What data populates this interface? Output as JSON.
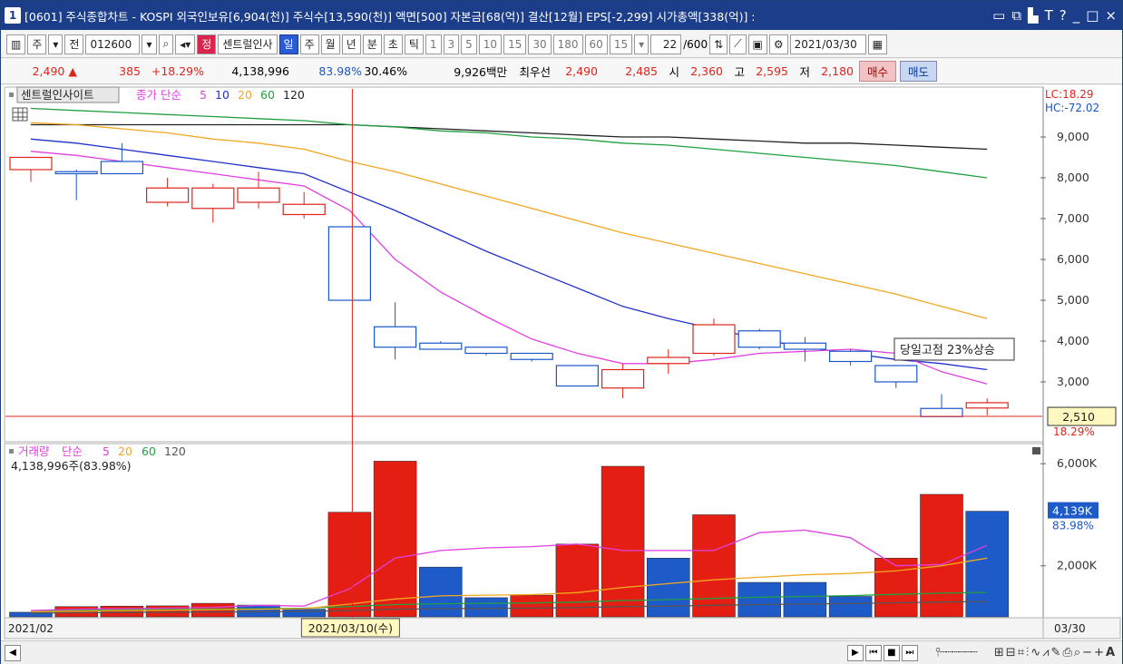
{
  "title": {
    "num": "1",
    "text": "[0601] 주식종합차트 - KOSPI 외국인보유[6,904(천)] 주식수[13,590(천)] 액면[500] 자본금[68(억)] 결산[12월] EPS[-2,299] 시가총액[338(억)] :",
    "controls": [
      "▭",
      "⧉",
      "▙",
      "T",
      "?",
      "_",
      "□",
      "×"
    ]
  },
  "toolbar": {
    "code": "012600",
    "name": "센트럴인사",
    "name_tag": "정",
    "periods": [
      "일",
      "주",
      "월",
      "년",
      "분",
      "초",
      "틱"
    ],
    "selected_period": "일",
    "minutes": [
      "1",
      "3",
      "5",
      "10",
      "15",
      "30",
      "180",
      "60"
    ],
    "interval": "15",
    "count": "22",
    "count_max": "/600",
    "date": "2021/03/30",
    "left_btns": [
      "주",
      "전"
    ]
  },
  "quote": {
    "price": "2,490",
    "arrow": "▲",
    "change": "385",
    "change_pct": "+18.29%",
    "volume": "4,138,996",
    "vol_ratio": "83.98%",
    "turnover": "30.46%",
    "amount": "9,926백만",
    "best_label": "최우선",
    "ask": "2,490",
    "bid": "2,485",
    "open_label": "시",
    "open": "2,360",
    "high_label": "고",
    "high": "2,595",
    "low_label": "저",
    "low": "2,180",
    "buy": "매수",
    "sell": "매도"
  },
  "price_panel": {
    "legend_name": "센트럴인사이트",
    "legend_ma": "종가 단순",
    "ma_periods": [
      "5",
      "10",
      "20",
      "60",
      "120"
    ],
    "lc_text": "LC:18.29",
    "hc_text": "HC:-72.02",
    "last_label": "2,510",
    "last_pct": "18.29%",
    "annotation": "당일고점  23%상승"
  },
  "volume_panel": {
    "legend_name": "거래량",
    "legend_ma": "단순",
    "ma_periods": [
      "5",
      "20",
      "60",
      "120"
    ],
    "info": "4,138,996주(83.98%)",
    "last_label": "4,139K",
    "last_pct": "83.98%"
  },
  "xaxis": {
    "start": "2021/02",
    "cursor_date": "2021/03/10(수)",
    "end": "03/30"
  },
  "colors": {
    "up": "#e0241b",
    "down": "#1a56c8",
    "ma5": "#e040e0",
    "ma10": "#2030d0",
    "ma20": "#f0a820",
    "ma60": "#20a040",
    "ma120": "#222222"
  },
  "chart_data": {
    "type": "candlestick",
    "price_axis": {
      "min": 2000,
      "max": 9500,
      "ticks": [
        9000,
        8000,
        7000,
        6000,
        5000,
        4000,
        3000
      ]
    },
    "volume_axis": {
      "min": 0,
      "max": 7000,
      "ticks": [
        6000,
        2000
      ],
      "tick_labels": [
        "6,000K",
        "2,000K"
      ]
    },
    "candles": [
      {
        "o": 8200,
        "h": 8500,
        "l": 7900,
        "c": 8500
      },
      {
        "o": 8150,
        "h": 8200,
        "l": 7450,
        "c": 8100
      },
      {
        "o": 8400,
        "h": 8850,
        "l": 8100,
        "c": 8100
      },
      {
        "o": 7400,
        "h": 8000,
        "l": 7300,
        "c": 7750
      },
      {
        "o": 7250,
        "h": 7850,
        "l": 6900,
        "c": 7750
      },
      {
        "o": 7400,
        "h": 8150,
        "l": 7250,
        "c": 7750
      },
      {
        "o": 7100,
        "h": 7650,
        "l": 7000,
        "c": 7350
      },
      {
        "o": 6800,
        "h": 6800,
        "l": 5000,
        "c": 5000
      },
      {
        "o": 4350,
        "h": 4950,
        "l": 3550,
        "c": 3850
      },
      {
        "o": 3950,
        "h": 4000,
        "l": 3800,
        "c": 3800
      },
      {
        "o": 3850,
        "h": 3850,
        "l": 3650,
        "c": 3700
      },
      {
        "o": 3700,
        "h": 3700,
        "l": 3500,
        "c": 3550
      },
      {
        "o": 3400,
        "h": 3400,
        "l": 2900,
        "c": 2900
      },
      {
        "o": 2850,
        "h": 3450,
        "l": 2600,
        "c": 3300
      },
      {
        "o": 3450,
        "h": 3800,
        "l": 3200,
        "c": 3600
      },
      {
        "o": 3700,
        "h": 4550,
        "l": 3650,
        "c": 4400
      },
      {
        "o": 4250,
        "h": 4300,
        "l": 3800,
        "c": 3850
      },
      {
        "o": 3950,
        "h": 4100,
        "l": 3500,
        "c": 3800
      },
      {
        "o": 3750,
        "h": 3800,
        "l": 3400,
        "c": 3500
      },
      {
        "o": 3400,
        "h": 3400,
        "l": 2850,
        "c": 3000
      },
      {
        "o": 2350,
        "h": 2700,
        "l": 2150,
        "c": 2150
      },
      {
        "o": 2360,
        "h": 2595,
        "l": 2180,
        "c": 2490
      }
    ],
    "volume": [
      180,
      400,
      420,
      430,
      530,
      460,
      300,
      4100,
      6100,
      1950,
      750,
      850,
      2850,
      5900,
      2300,
      4000,
      1350,
      1350,
      800,
      2300,
      4800,
      4139
    ],
    "volume_up": [
      false,
      true,
      true,
      true,
      true,
      false,
      false,
      true,
      true,
      false,
      false,
      true,
      true,
      true,
      false,
      true,
      false,
      false,
      false,
      true,
      true,
      false
    ],
    "ma5": [
      8650,
      8550,
      8400,
      8250,
      8100,
      7950,
      7800,
      7200,
      6000,
      5200,
      4600,
      4050,
      3700,
      3450,
      3450,
      3550,
      3700,
      3750,
      3800,
      3700,
      3250,
      2950
    ],
    "ma10": [
      8950,
      8850,
      8700,
      8550,
      8400,
      8250,
      8100,
      7650,
      7200,
      6700,
      6200,
      5750,
      5300,
      4850,
      4550,
      4300,
      4050,
      3850,
      3700,
      3550,
      3450,
      3300
    ],
    "ma20": [
      9350,
      9300,
      9200,
      9100,
      8950,
      8850,
      8700,
      8400,
      8150,
      7850,
      7550,
      7250,
      6950,
      6650,
      6400,
      6150,
      5900,
      5650,
      5400,
      5150,
      4850,
      4550
    ],
    "ma60": [
      9700,
      9650,
      9600,
      9550,
      9500,
      9450,
      9400,
      9300,
      9250,
      9150,
      9100,
      9000,
      8950,
      8850,
      8800,
      8700,
      8600,
      8500,
      8400,
      8300,
      8150,
      8000
    ],
    "ma120": [
      9300,
      9300,
      9300,
      9300,
      9300,
      9300,
      9300,
      9300,
      9250,
      9200,
      9150,
      9100,
      9050,
      9000,
      9000,
      8950,
      8900,
      8850,
      8850,
      8800,
      8750,
      8700
    ],
    "vol_ma5": [
      250,
      300,
      320,
      340,
      370,
      450,
      420,
      1100,
      2300,
      2600,
      2700,
      2750,
      2850,
      2600,
      2600,
      2600,
      3300,
      3400,
      3100,
      2000,
      2050,
      2800
    ],
    "vol_ma20": [
      200,
      220,
      240,
      260,
      280,
      300,
      320,
      500,
      700,
      820,
      850,
      870,
      950,
      1150,
      1300,
      1450,
      1550,
      1650,
      1700,
      1800,
      2000,
      2300
    ],
    "vol_ma60": [
      150,
      160,
      170,
      180,
      190,
      200,
      210,
      250,
      300,
      320,
      330,
      340,
      360,
      400,
      420,
      450,
      480,
      500,
      520,
      550,
      580,
      600
    ],
    "cursor_index": 7,
    "last_price": 2510
  }
}
